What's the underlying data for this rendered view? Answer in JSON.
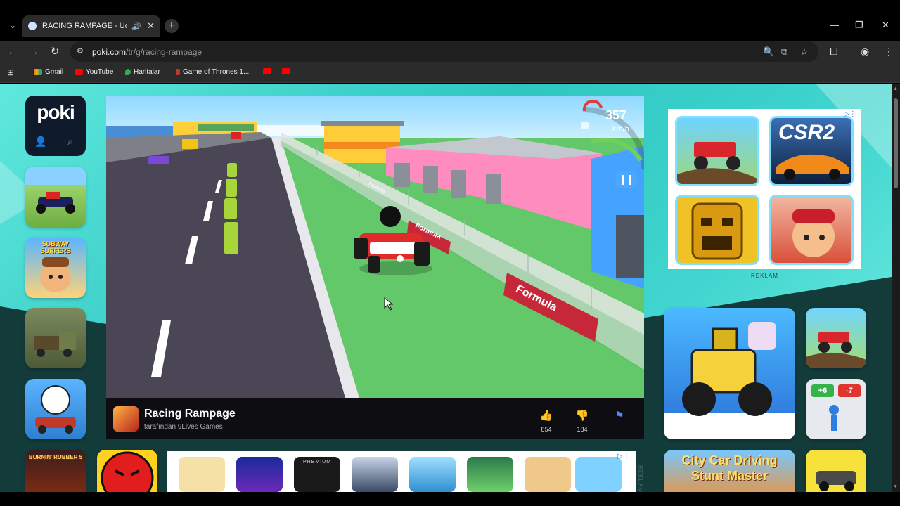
{
  "browser": {
    "tab_title": "RACING RAMPAGE - Ücretsiz",
    "url_host": "poki.com",
    "url_path": "/tr/g/racing-rampage",
    "bookmarks": [
      "Gmail",
      "YouTube",
      "Haritalar",
      "Game of Thrones 1..."
    ]
  },
  "sidebar": {
    "logo": "poki",
    "thumbs": [
      {
        "caption": ""
      },
      {
        "caption": "SUBWAY SURFERS"
      },
      {
        "caption": ""
      },
      {
        "caption": ""
      },
      {
        "caption": "BURNIN' RUBBER 5"
      }
    ]
  },
  "game": {
    "speed": "357",
    "speed_unit": "km/h",
    "wall_text_1": "Formula",
    "wall_text_2": "Formula",
    "wall_text_3": "Formula"
  },
  "game_bar": {
    "title": "Racing Rampage",
    "author": "tarafından 9Lives Games",
    "likes": "854",
    "dislikes": "184"
  },
  "ads": {
    "label": "REKLAM",
    "csr_text": "CSR2",
    "strip_label": "REKLAM",
    "premium": "PREMIUM"
  },
  "right_thumbs": {
    "plus": "+6",
    "minus": "-7",
    "city_car": "City Car Driving Stunt Master"
  },
  "colors": {
    "page_bg": "#41d6cf",
    "poki_blue": "#4f8cff",
    "game_bar": "#0e0e12"
  }
}
